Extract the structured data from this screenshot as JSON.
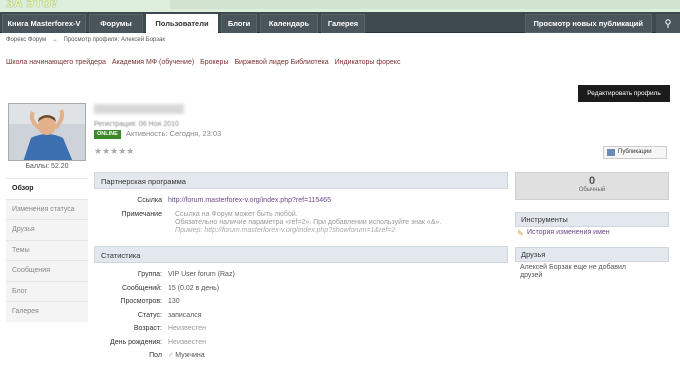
{
  "banner": {
    "text": "ЗА ЭТО?"
  },
  "nav": {
    "tabs": [
      "Книга Masterforex-V",
      "Форумы",
      "Пользователи",
      "Блоги",
      "Календарь",
      "Галерея"
    ],
    "active": "Пользователи",
    "right_label": "Просмотр новых публикаций",
    "pin_icon": "pin-icon"
  },
  "breadcrumb": [
    "Форекс Форум",
    "→",
    "Просмотр профиля: Алексей Борзак"
  ],
  "links": [
    "Школа начинающего трейдера",
    "Академия МФ (обучение)",
    "Брокеры",
    "Биржевой лидер Библиотека",
    "Индикаторы форекс"
  ],
  "profile": {
    "edit_label": "Редактировать профиль",
    "points": "Баллы: 52.20",
    "registration": "Регистрация: 06 Ноя 2010",
    "online_badge": "ONLINE",
    "activity": "Активность: Сегодня, 23:03",
    "stars": "★★★★★",
    "publications_label": "Публикации"
  },
  "sidebar": {
    "items": [
      "Обзор",
      "Изменения статуса",
      "Друзья",
      "Темы",
      "Сообщения",
      "Блог",
      "Галерея"
    ],
    "active": "Обзор"
  },
  "partner": {
    "title": "Партнерская программа",
    "link_label": "Ссылка",
    "link_value": "http://forum.masterforex-v.org/index.php?ref=115465",
    "note_label": "Примечание",
    "note_line1": "Ссылка на Форум может быть любой.",
    "note_line2": "Обязательно наличие параметра «ref=2». При добавлении используйте знак «&».",
    "note_line3": "Пример: http://forum.masterforex-v.org/index.php?showforum=1&ref=2"
  },
  "stats": {
    "title": "Статистика",
    "rows": [
      {
        "label": "Группа:",
        "value": "VIP User forum (Raz)",
        "style": ""
      },
      {
        "label": "Сообщений:",
        "value": "15 (0.02 в день)",
        "style": ""
      },
      {
        "label": "Просмотров:",
        "value": "130",
        "style": ""
      },
      {
        "label": "Статус:",
        "value": "записался",
        "style": ""
      },
      {
        "label": "Возраст:",
        "value": "Неизвестен",
        "style": "grey"
      },
      {
        "label": "День рождения:",
        "value": "Неизвестен",
        "style": "grey"
      },
      {
        "label": "Пол",
        "value": "Мужчина",
        "style": ""
      }
    ]
  },
  "right": {
    "rep_value": "0",
    "rep_label": "Обычный",
    "tools_title": "Инструменты",
    "tools_link": "История изменения имен",
    "friends_title": "Друзья",
    "friends_text_1": "Алексей Борзак еще не добавил",
    "friends_text_2": "друзей"
  },
  "colors": {
    "nav_bg": "#3f4a50",
    "online": "#3a8a2a",
    "link": "#7a3030",
    "section_bg": "#e3e8ee"
  }
}
